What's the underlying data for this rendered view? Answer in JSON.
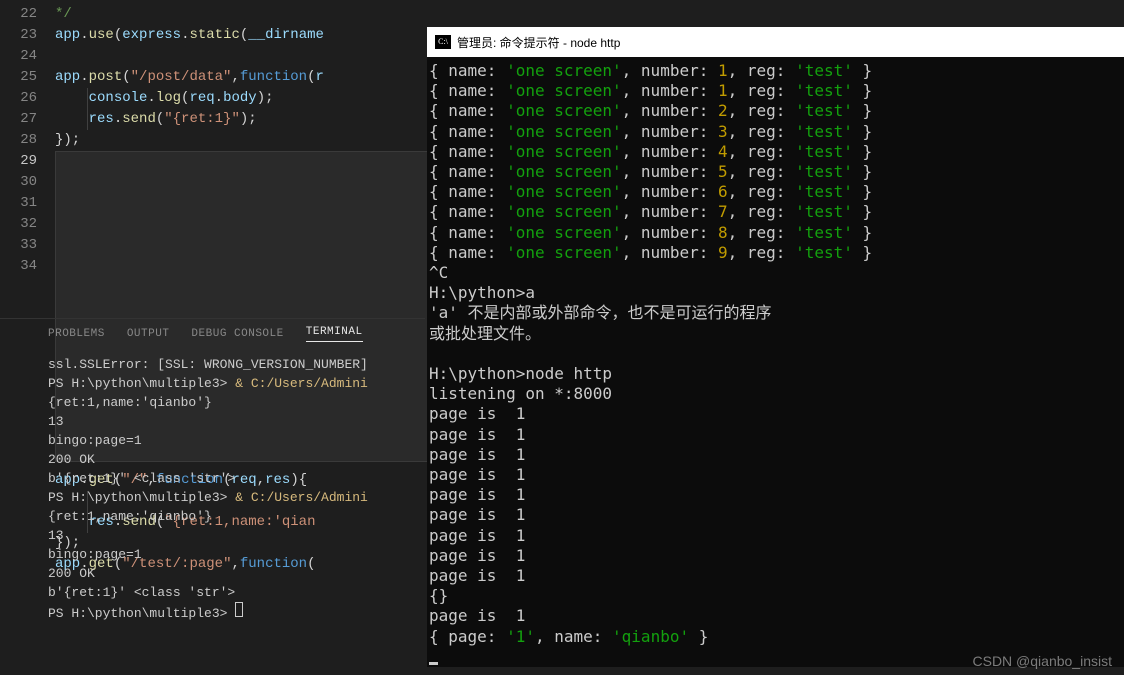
{
  "editor": {
    "first_line": 22,
    "lines": [
      {
        "n": 22,
        "tokens": [
          {
            "t": "*/",
            "c": "c-comment"
          }
        ]
      },
      {
        "n": 23,
        "tokens": [
          {
            "t": "app",
            "c": "c-var"
          },
          {
            "t": ".",
            "c": "c-punc"
          },
          {
            "t": "use",
            "c": "c-func"
          },
          {
            "t": "(",
            "c": "c-punc"
          },
          {
            "t": "express",
            "c": "c-var"
          },
          {
            "t": ".",
            "c": "c-punc"
          },
          {
            "t": "static",
            "c": "c-func"
          },
          {
            "t": "(",
            "c": "c-punc"
          },
          {
            "t": "__dirname",
            "c": "c-var"
          }
        ]
      },
      {
        "n": 24,
        "tokens": []
      },
      {
        "n": 25,
        "tokens": [
          {
            "t": "app",
            "c": "c-var"
          },
          {
            "t": ".",
            "c": "c-punc"
          },
          {
            "t": "post",
            "c": "c-func"
          },
          {
            "t": "(",
            "c": "c-punc"
          },
          {
            "t": "\"/post/data\"",
            "c": "c-str"
          },
          {
            "t": ",",
            "c": "c-punc"
          },
          {
            "t": "function",
            "c": "c-kw"
          },
          {
            "t": "(",
            "c": "c-punc"
          },
          {
            "t": "r",
            "c": "c-var"
          }
        ]
      },
      {
        "n": 26,
        "indent": 2,
        "tokens": [
          {
            "t": "console",
            "c": "c-var"
          },
          {
            "t": ".",
            "c": "c-punc"
          },
          {
            "t": "log",
            "c": "c-func"
          },
          {
            "t": "(",
            "c": "c-punc"
          },
          {
            "t": "req",
            "c": "c-var"
          },
          {
            "t": ".",
            "c": "c-punc"
          },
          {
            "t": "body",
            "c": "c-var"
          },
          {
            "t": ");",
            "c": "c-punc"
          }
        ]
      },
      {
        "n": 27,
        "indent": 2,
        "tokens": [
          {
            "t": "res",
            "c": "c-var"
          },
          {
            "t": ".",
            "c": "c-punc"
          },
          {
            "t": "send",
            "c": "c-func"
          },
          {
            "t": "(",
            "c": "c-punc"
          },
          {
            "t": "\"{ret:1}\"",
            "c": "c-str"
          },
          {
            "t": ");",
            "c": "c-punc"
          }
        ]
      },
      {
        "n": 28,
        "tokens": [
          {
            "t": "});",
            "c": "c-punc"
          }
        ]
      },
      {
        "n": 29,
        "current": true,
        "tokens": []
      },
      {
        "n": 30,
        "tokens": [
          {
            "t": "app",
            "c": "c-var"
          },
          {
            "t": ".",
            "c": "c-punc"
          },
          {
            "t": "get",
            "c": "c-func"
          },
          {
            "t": "(",
            "c": "c-punc"
          },
          {
            "t": "\"/\"",
            "c": "c-str"
          },
          {
            "t": ",",
            "c": "c-punc"
          },
          {
            "t": "function",
            "c": "c-kw"
          },
          {
            "t": "(",
            "c": "c-punc"
          },
          {
            "t": "req",
            "c": "c-var"
          },
          {
            "t": ",",
            "c": "c-punc"
          },
          {
            "t": "res",
            "c": "c-var"
          },
          {
            "t": "){",
            "c": "c-punc"
          }
        ]
      },
      {
        "n": 31,
        "indent": 2,
        "tokens": []
      },
      {
        "n": 32,
        "indent": 2,
        "tokens": [
          {
            "t": "res",
            "c": "c-var"
          },
          {
            "t": ".",
            "c": "c-punc"
          },
          {
            "t": "send",
            "c": "c-func"
          },
          {
            "t": "(",
            "c": "c-punc"
          },
          {
            "t": "\"{ret:1,name:'qian",
            "c": "c-str"
          }
        ]
      },
      {
        "n": 33,
        "tokens": [
          {
            "t": "});",
            "c": "c-punc"
          }
        ]
      },
      {
        "n": 34,
        "tokens": [
          {
            "t": "app",
            "c": "c-var"
          },
          {
            "t": ".",
            "c": "c-punc"
          },
          {
            "t": "get",
            "c": "c-func"
          },
          {
            "t": "(",
            "c": "c-punc"
          },
          {
            "t": "\"/test/:page\"",
            "c": "c-str"
          },
          {
            "t": ",",
            "c": "c-punc"
          },
          {
            "t": "function",
            "c": "c-kw"
          },
          {
            "t": "(",
            "c": "c-punc"
          }
        ]
      }
    ]
  },
  "panel": {
    "tabs": [
      "PROBLEMS",
      "OUTPUT",
      "DEBUG CONSOLE",
      "TERMINAL"
    ],
    "active": 3
  },
  "terminal": {
    "lines": [
      [
        {
          "t": "ssl.SSLError: [SSL: WRONG_VERSION_NUMBER]"
        }
      ],
      [
        {
          "t": "PS H:\\python\\multiple3> "
        },
        {
          "t": "& ",
          "c": "term-yellow"
        },
        {
          "t": "C:/Users/Admini",
          "c": "term-yellow"
        }
      ],
      [
        {
          "t": "{ret:1,name:'qianbo'}"
        }
      ],
      [
        {
          "t": "13"
        }
      ],
      [
        {
          "t": "bingo:page=1"
        }
      ],
      [
        {
          "t": "200 OK"
        }
      ],
      [
        {
          "t": "b'{ret:1}' <class 'str'>"
        }
      ],
      [
        {
          "t": "PS H:\\python\\multiple3> "
        },
        {
          "t": "& ",
          "c": "term-yellow"
        },
        {
          "t": "C:/Users/Admini",
          "c": "term-yellow"
        }
      ],
      [
        {
          "t": "{ret:1,name:'qianbo'}"
        }
      ],
      [
        {
          "t": "13"
        }
      ],
      [
        {
          "t": "bingo:page=1"
        }
      ],
      [
        {
          "t": "200 OK"
        }
      ],
      [
        {
          "t": "b'{ret:1}' <class 'str'>"
        }
      ],
      [
        {
          "t": "PS H:\\python\\multiple3> "
        }
      ]
    ]
  },
  "cmd": {
    "title": "管理员: 命令提示符 - node  http",
    "rows": [
      {
        "name": "one screen",
        "number": 1,
        "reg": "test"
      },
      {
        "name": "one screen",
        "number": 1,
        "reg": "test"
      },
      {
        "name": "one screen",
        "number": 2,
        "reg": "test"
      },
      {
        "name": "one screen",
        "number": 3,
        "reg": "test"
      },
      {
        "name": "one screen",
        "number": 4,
        "reg": "test"
      },
      {
        "name": "one screen",
        "number": 5,
        "reg": "test"
      },
      {
        "name": "one screen",
        "number": 6,
        "reg": "test"
      },
      {
        "name": "one screen",
        "number": 7,
        "reg": "test"
      },
      {
        "name": "one screen",
        "number": 8,
        "reg": "test"
      },
      {
        "name": "one screen",
        "number": 9,
        "reg": "test"
      }
    ],
    "mid": [
      "^C",
      "H:\\python>a",
      "'a' 不是内部或外部命令，也不是可运行的程序",
      "或批处理文件。",
      "",
      "H:\\python>node http",
      "listening on *:8000"
    ],
    "pages": [
      1,
      1,
      1,
      1,
      1,
      1,
      1,
      1,
      1
    ],
    "emptyobj": "{}",
    "page_after": 1,
    "last_page": "1",
    "last_name": "qianbo"
  },
  "watermark": "CSDN @qianbo_insist"
}
